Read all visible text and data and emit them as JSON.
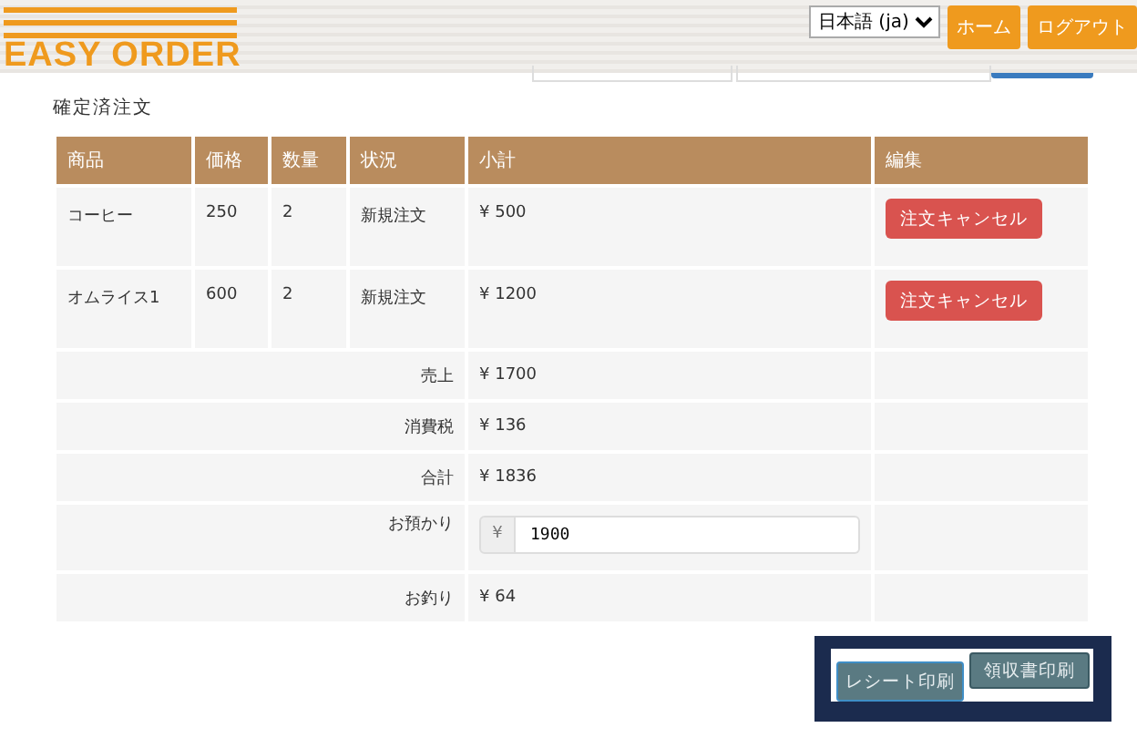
{
  "header": {
    "logo": "EASY ORDER",
    "language": "日本語 (ja)",
    "nav": [
      "ホーム",
      "ログアウト"
    ]
  },
  "title": "確定済注文",
  "table": {
    "columns": [
      "商品",
      "価格",
      "数量",
      "状況",
      "小計",
      "編集"
    ],
    "rows": [
      {
        "item": "コーヒー",
        "price": "250",
        "qty": "2",
        "status": "新規注文",
        "subtotal": "¥ 500",
        "action": "注文キャンセル"
      },
      {
        "item": "オムライス1",
        "price": "600",
        "qty": "2",
        "status": "新規注文",
        "subtotal": "¥ 1200",
        "action": "注文キャンセル"
      }
    ],
    "summary": [
      {
        "kind": "text",
        "label": "売上",
        "value": "¥ 1700"
      },
      {
        "kind": "text",
        "label": "消費税",
        "value": "¥ 136"
      },
      {
        "kind": "text",
        "label": "合計",
        "value": "¥ 1836"
      },
      {
        "kind": "input",
        "label": "お預かり",
        "prefix": "¥",
        "value": "1900"
      },
      {
        "kind": "text",
        "label": "お釣り",
        "value": "¥ 64"
      }
    ]
  },
  "print_buttons": [
    "レシート印刷",
    "領収書印刷"
  ]
}
